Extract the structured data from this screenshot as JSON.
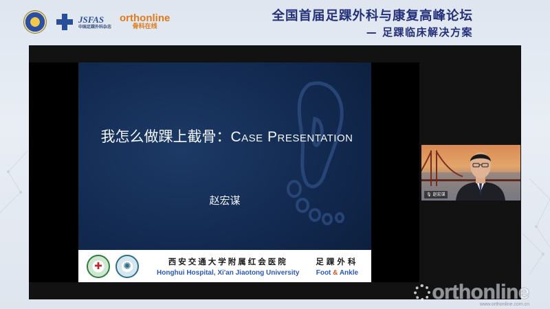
{
  "header": {
    "logos": [
      "conference-emblem",
      "medical-cross-logo",
      "jsfas-logo",
      "orthonline-logo"
    ],
    "logo_jsfas_text": "JSFAS",
    "logo_jsfas_sub": "中国足踝外科杂志",
    "logo_orthonline_text": "orthonline",
    "logo_orthonline_sub": "骨科在线",
    "title": "全国首届足踝外科与康复高峰论坛",
    "subtitle": "— 足踝临床解决方案"
  },
  "slide": {
    "title_cjk": "我怎么做踝上截骨：",
    "title_latin": "Case Presentation",
    "author": "赵宏谋",
    "footer": {
      "hospital_cn": "西安交通大学附属红会医院",
      "hospital_en": "Honghui Hospital, Xi'an Jiaotong University",
      "dept_cn": "足踝外科",
      "dept_en_1": "Foot",
      "dept_en_amp": "&",
      "dept_en_2": "Ankle"
    }
  },
  "webcam": {
    "name_tag": "赵宏谋"
  },
  "watermark": {
    "text": "orthonline",
    "url": "www.orthonline.com.cn"
  },
  "colors": {
    "header_text": "#24307a",
    "slide_bg": "#12294f",
    "hospital_en": "#2a58b8",
    "ampersand": "#e0531f",
    "orthonline_orange": "#e07a1a"
  }
}
